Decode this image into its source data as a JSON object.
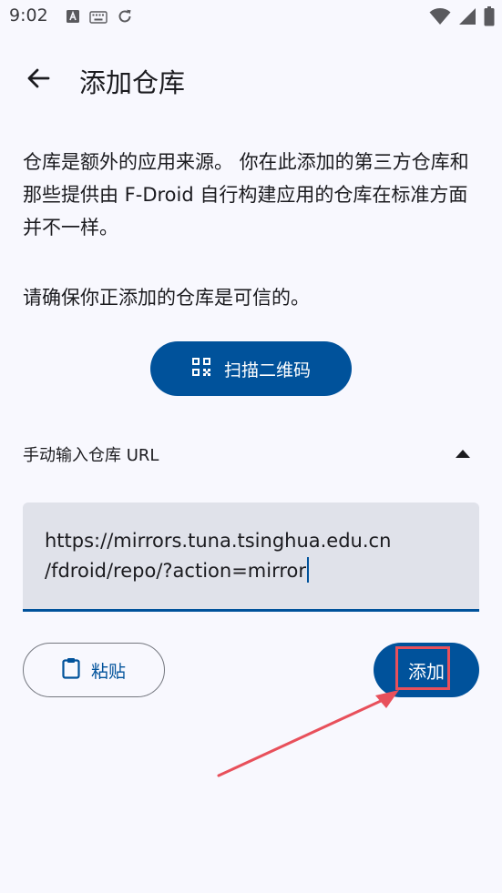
{
  "status_bar": {
    "time": "9:02"
  },
  "app_bar": {
    "title": "添加仓库"
  },
  "content": {
    "description": "仓库是额外的应用来源。 你在此添加的第三方仓库和那些提供由 F-Droid 自行构建应用的仓库在标准方面并不一样。",
    "trust_note": "请确保你正添加的仓库是可信的。"
  },
  "scan_button": {
    "label": "扫描二维码",
    "icon": "qr-code-icon"
  },
  "manual_section": {
    "label": "手动输入仓库 URL",
    "expanded": true,
    "icon": "arrow-drop-up-icon"
  },
  "url_field": {
    "line1": "https://mirrors.tuna.tsinghua.edu.cn",
    "line2": "/fdroid/repo/?action=mirror"
  },
  "paste_button": {
    "label": "粘贴",
    "icon": "clipboard-icon"
  },
  "add_button": {
    "label": "添加"
  },
  "colors": {
    "primary": "#00529b",
    "background": "#f8f8fe",
    "field_background": "#e0e2ea",
    "annotation": "#e8505b"
  }
}
